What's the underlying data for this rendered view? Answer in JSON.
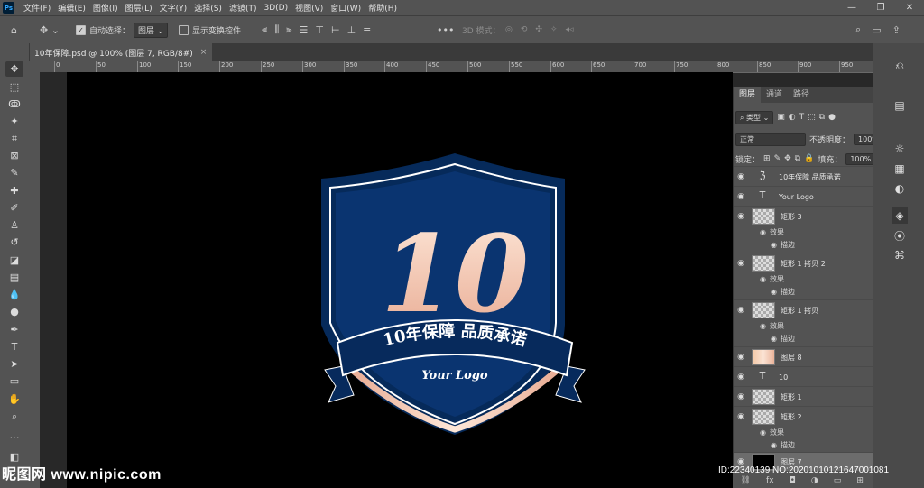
{
  "menubar": {
    "logo": "Ps",
    "items": [
      "文件(F)",
      "编辑(E)",
      "图像(I)",
      "图层(L)",
      "文字(Y)",
      "选择(S)",
      "滤镜(T)",
      "3D(D)",
      "视图(V)",
      "窗口(W)",
      "帮助(H)"
    ],
    "window_controls": [
      "—",
      "❐",
      "✕"
    ]
  },
  "optionsbar": {
    "auto_select_label": "自动选择：",
    "auto_select_checked": true,
    "auto_select_target": "图层",
    "show_transform_label": "显示变换控件",
    "show_transform_checked": false,
    "mode_3d_label": "3D 模式：",
    "more_icon": "•••"
  },
  "document_tab": {
    "title": "10年保障.psd @ 100% (图层 7, RGB/8#)",
    "close": "×"
  },
  "ruler": {
    "h_ticks": [
      "0",
      "50",
      "100",
      "150",
      "200",
      "250",
      "300",
      "350",
      "400",
      "450",
      "500",
      "550",
      "600",
      "650",
      "700",
      "750",
      "800",
      "850",
      "900",
      "950"
    ]
  },
  "badge": {
    "number": "10",
    "ribbon_text": "10年保障 品质承诺",
    "logo_text": "Your Logo",
    "colors": {
      "shield_dark": "#062a5a",
      "shield_inner": "#0a3470",
      "ribbon": "#072a5c",
      "gold_light": "#fde7d8",
      "gold_dark": "#e9ac94"
    }
  },
  "layers_panel": {
    "tabs": [
      "图层",
      "通道",
      "路径"
    ],
    "active_tab": "图层",
    "filter_label": "类型",
    "blend_mode": "正常",
    "opacity_label": "不透明度：",
    "opacity_value": "100%",
    "lock_label": "锁定：",
    "fill_label": "填充：",
    "fill_value": "100%",
    "layers": [
      {
        "name": "10年保障  品质承诺",
        "kind": "text-warp",
        "fx": false
      },
      {
        "name": "Your Logo",
        "kind": "text",
        "fx": false
      },
      {
        "name": "矩形 3",
        "kind": "shape",
        "fx": true,
        "effects_label": "效果",
        "effect": "描边"
      },
      {
        "name": "矩形 1 拷贝 2",
        "kind": "shape",
        "fx": true,
        "effects_label": "效果",
        "effect": "描边"
      },
      {
        "name": "矩形 1 拷贝",
        "kind": "shape",
        "fx": true,
        "effects_label": "效果",
        "effect": "描边"
      },
      {
        "name": "图层 8",
        "kind": "gradient",
        "fx": false
      },
      {
        "name": "10",
        "kind": "text",
        "fx": false
      },
      {
        "name": "矩形 1",
        "kind": "shape",
        "fx": false
      },
      {
        "name": "矩形 2",
        "kind": "shape",
        "fx": true,
        "effects_label": "效果",
        "effect": "描边"
      },
      {
        "name": "图层 7",
        "kind": "black",
        "fx": false
      }
    ]
  },
  "watermark": {
    "left": "昵图网 www.nipic.com",
    "right": "ID:22340139 NO:20201010121647001081"
  }
}
